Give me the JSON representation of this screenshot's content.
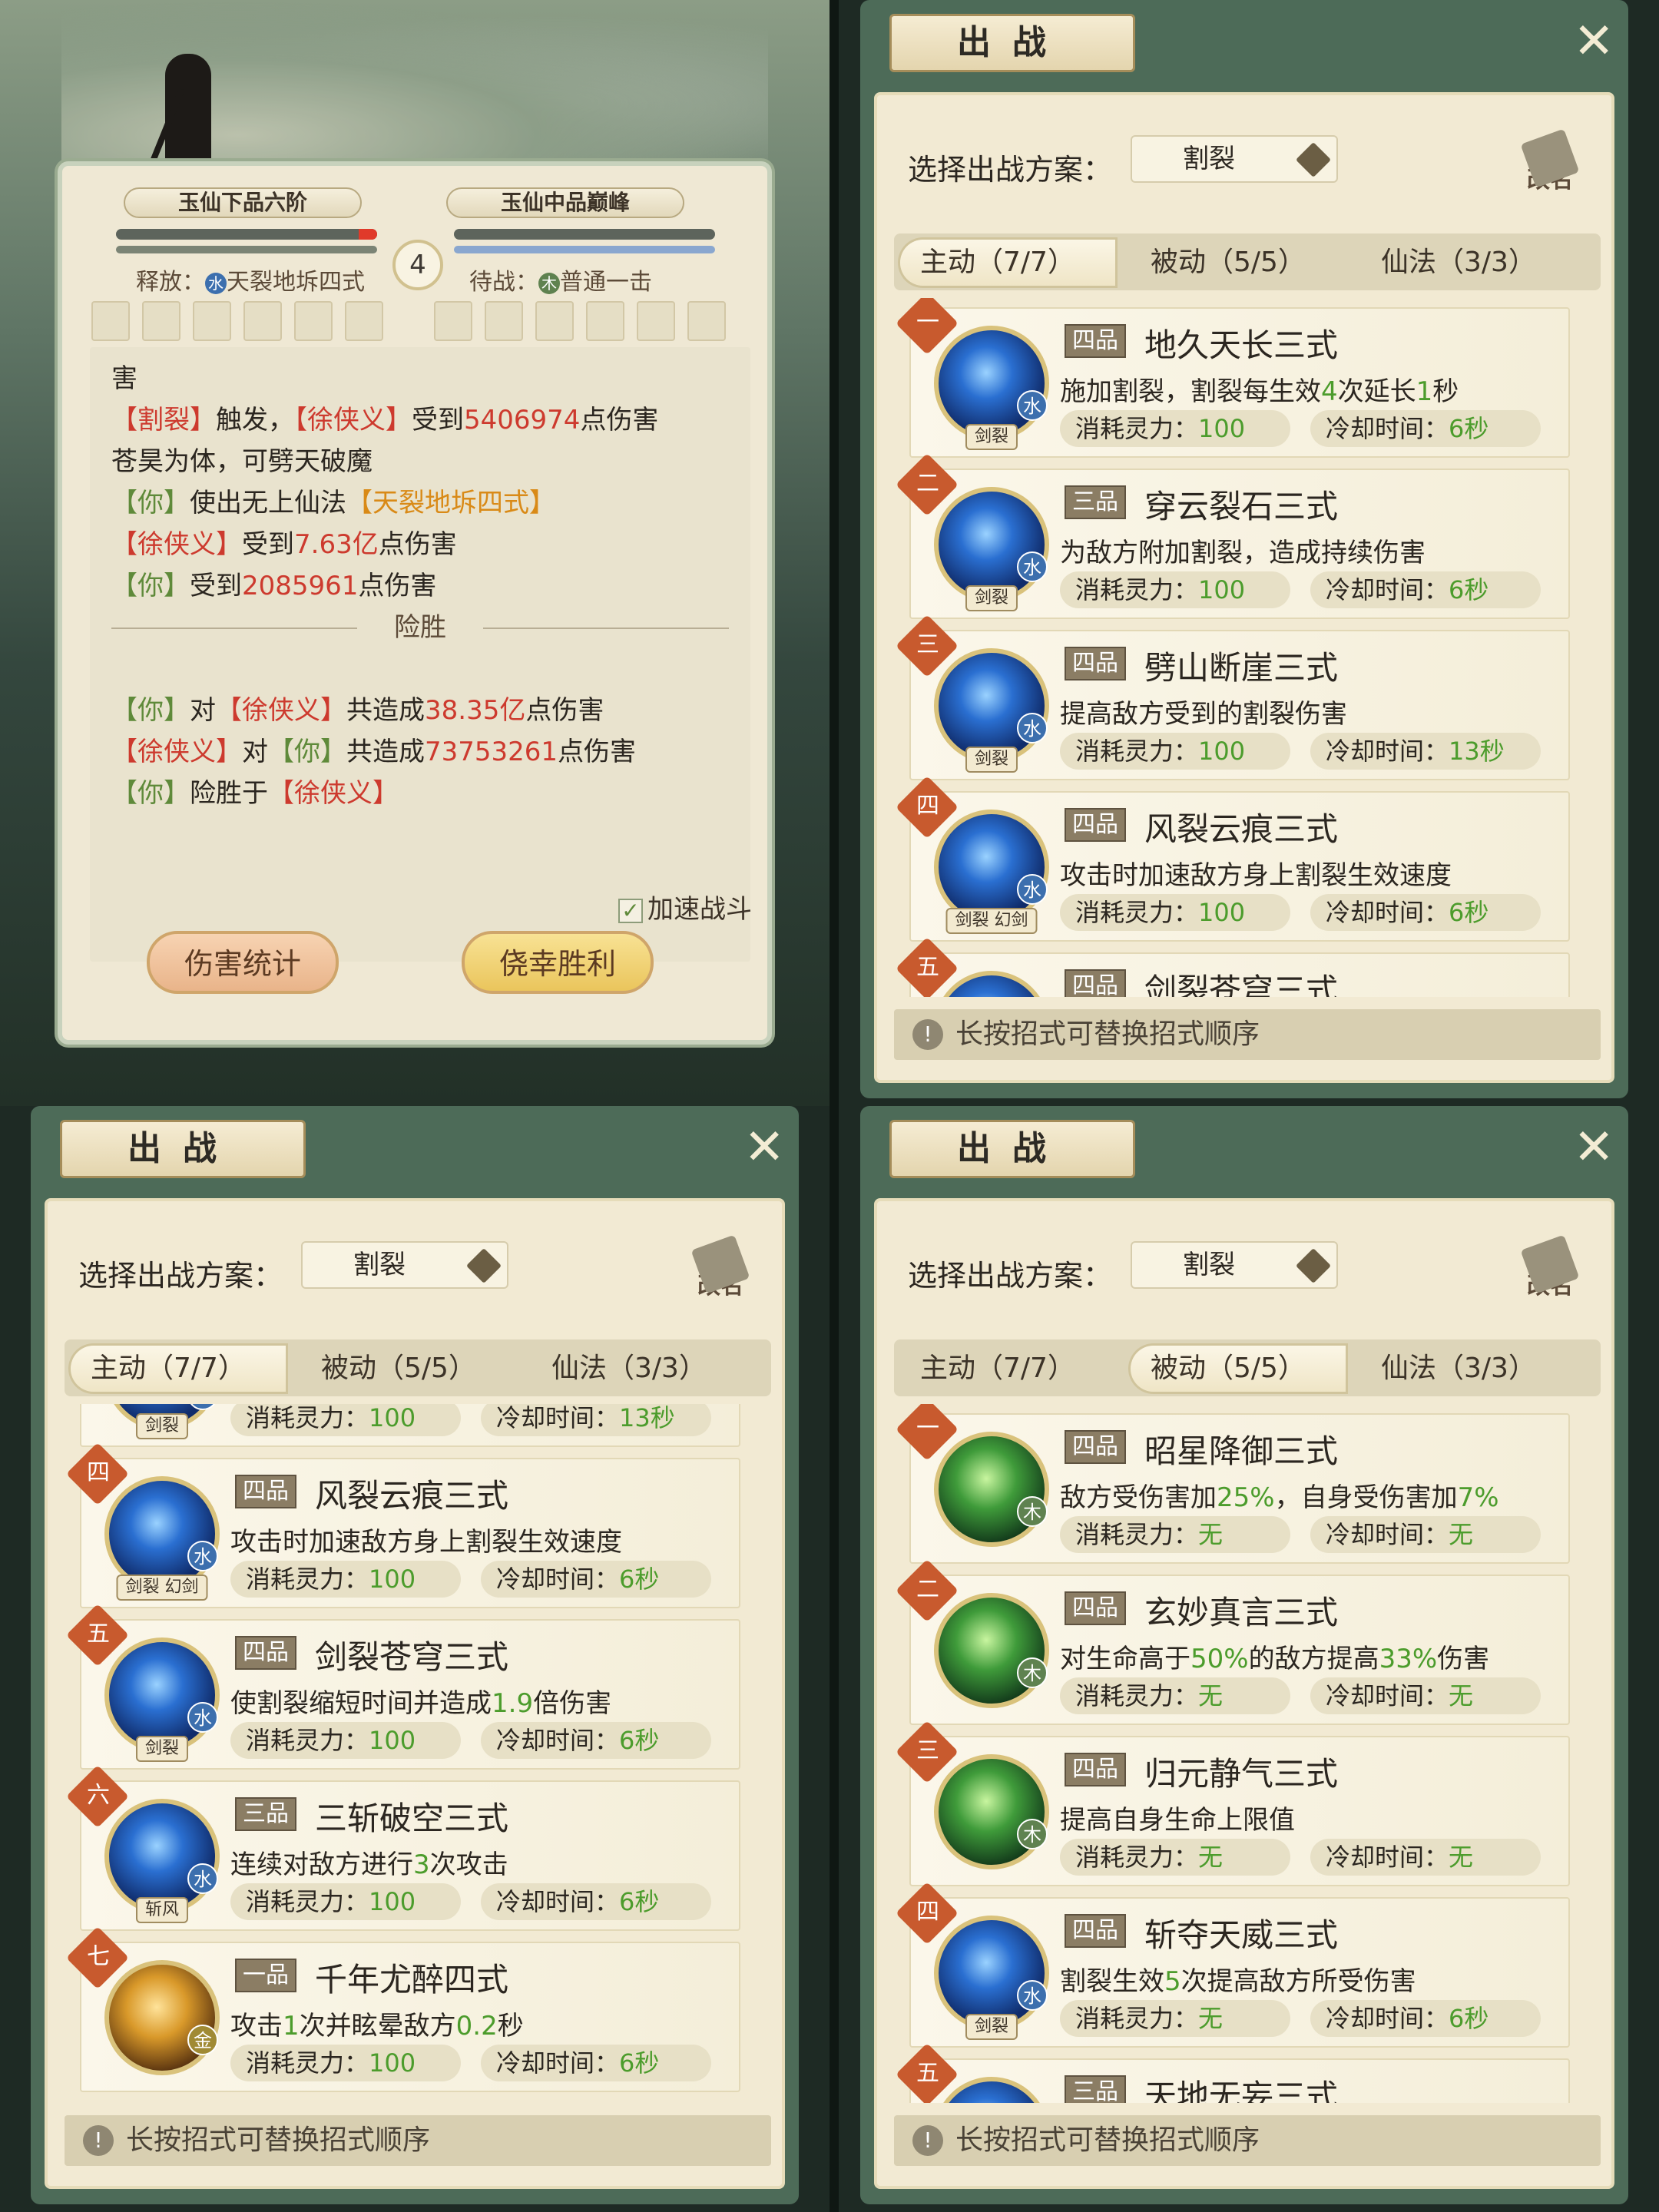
{
  "battle": {
    "rank_left": "玉仙下品六阶",
    "rank_right": "玉仙中品巅峰",
    "round": "4",
    "release_label": "释放：",
    "release_elem": "水",
    "release_skill": "天裂地坼四式",
    "wait_label": "待战：",
    "wait_elem": "木",
    "wait_skill": "普通一击",
    "hp_left_fraction": 0.07,
    "hp_right_fraction": 1.0,
    "log": [
      [
        {
          "t": "害",
          "c": ""
        }
      ],
      [
        {
          "t": "【割裂】",
          "c": "r"
        },
        {
          "t": "触发，",
          "c": ""
        },
        {
          "t": "【徐侠义】",
          "c": "r"
        },
        {
          "t": "受到",
          "c": ""
        },
        {
          "t": "5406974",
          "c": "r"
        },
        {
          "t": "点伤害",
          "c": ""
        }
      ],
      [
        {
          "t": " ",
          "c": ""
        }
      ],
      [
        {
          "t": "苍昊为体，可劈天破魔",
          "c": ""
        }
      ],
      [
        {
          "t": "【你】",
          "c": "g"
        },
        {
          "t": "使出无上仙法",
          "c": ""
        },
        {
          "t": "【天裂地坼四式】",
          "c": "o"
        }
      ],
      [
        {
          "t": "【徐侠义】",
          "c": "r"
        },
        {
          "t": "受到",
          "c": ""
        },
        {
          "t": "7.63亿",
          "c": "r"
        },
        {
          "t": "点伤害",
          "c": ""
        }
      ],
      [
        {
          "t": "【你】",
          "c": "g"
        },
        {
          "t": "受到",
          "c": ""
        },
        {
          "t": "2085961",
          "c": "r"
        },
        {
          "t": "点伤害",
          "c": ""
        }
      ]
    ],
    "result_title": "险胜",
    "summary": [
      [
        {
          "t": "【你】",
          "c": "g"
        },
        {
          "t": "对",
          "c": ""
        },
        {
          "t": "【徐侠义】",
          "c": "r"
        },
        {
          "t": "共造成",
          "c": ""
        },
        {
          "t": "38.35亿",
          "c": "r"
        },
        {
          "t": "点伤害",
          "c": ""
        }
      ],
      [
        {
          "t": "【徐侠义】",
          "c": "r"
        },
        {
          "t": "对",
          "c": ""
        },
        {
          "t": "【你】",
          "c": "g"
        },
        {
          "t": "共造成",
          "c": ""
        },
        {
          "t": "73753261",
          "c": "r"
        },
        {
          "t": "点伤害",
          "c": ""
        }
      ],
      [
        {
          "t": "【你】",
          "c": "g"
        },
        {
          "t": "险胜于",
          "c": ""
        },
        {
          "t": "【徐侠义】",
          "c": "r"
        }
      ]
    ],
    "speed_label": "加速战斗",
    "btn_stats": "伤害统计",
    "btn_win": "侥幸胜利"
  },
  "deploy": {
    "title": "出战",
    "plan_label": "选择出战方案：",
    "plan_value": "割裂",
    "rename": "改名",
    "tab_active": "主动（7/7）",
    "tab_passive": "被动（5/5）",
    "tab_magic": "仙法（3/3）",
    "tip": "长按招式可替换招式顺序",
    "cost_label": "消耗灵力：",
    "cd_label": "冷却时间："
  },
  "active_skills": [
    {
      "rank": "一",
      "grade": "四品",
      "name": "地久天长三式",
      "desc": "施加割裂，割裂每生效4次延长1秒",
      "elem": "水",
      "tag": "剑裂",
      "cost": "100",
      "cd": "6秒"
    },
    {
      "rank": "二",
      "grade": "三品",
      "name": "穿云裂石三式",
      "desc": "为敌方附加割裂，造成持续伤害",
      "elem": "水",
      "tag": "剑裂",
      "cost": "100",
      "cd": "6秒"
    },
    {
      "rank": "三",
      "grade": "四品",
      "name": "劈山断崖三式",
      "desc": "提高敌方受到的割裂伤害",
      "elem": "水",
      "tag": "剑裂",
      "cost": "100",
      "cd": "13秒"
    },
    {
      "rank": "四",
      "grade": "四品",
      "name": "风裂云痕三式",
      "desc": "攻击时加速敌方身上割裂生效速度",
      "elem": "水",
      "tag": "剑裂 幻剑",
      "cost": "100",
      "cd": "6秒"
    },
    {
      "rank": "五",
      "grade": "四品",
      "name": "剑裂苍穹三式",
      "desc": "",
      "elem": "水",
      "tag": "剑裂",
      "cost": "",
      "cd": ""
    }
  ],
  "active_skills_scrolled": [
    {
      "rank": "",
      "grade": "",
      "name": "",
      "desc": "提高敌方受到的割裂伤害",
      "elem": "水",
      "tag": "剑裂",
      "cost": "100",
      "cd": "13秒"
    },
    {
      "rank": "四",
      "grade": "四品",
      "name": "风裂云痕三式",
      "desc": "攻击时加速敌方身上割裂生效速度",
      "elem": "水",
      "tag": "剑裂 幻剑",
      "cost": "100",
      "cd": "6秒"
    },
    {
      "rank": "五",
      "grade": "四品",
      "name": "剑裂苍穹三式",
      "desc": "使割裂缩短时间并造成1.9倍伤害",
      "elem": "水",
      "tag": "剑裂",
      "cost": "100",
      "cd": "6秒"
    },
    {
      "rank": "六",
      "grade": "三品",
      "name": "三斩破空三式",
      "desc": "连续对敌方进行3次攻击",
      "elem": "水",
      "tag": "斩风",
      "cost": "100",
      "cd": "6秒"
    },
    {
      "rank": "七",
      "grade": "一品",
      "name": "千年尤醉四式",
      "desc": "攻击1次并眩晕敌方0.2秒",
      "elem": "金",
      "tag": "",
      "cost": "100",
      "cd": "6秒"
    }
  ],
  "passive_skills": [
    {
      "rank": "一",
      "grade": "四品",
      "name": "昭星降御三式",
      "desc": "敌方受伤害加25%，自身受伤害加7%",
      "elem": "木",
      "tag": "",
      "cost": "无",
      "cd": "无"
    },
    {
      "rank": "二",
      "grade": "四品",
      "name": "玄妙真言三式",
      "desc": "对生命高于50%的敌方提高33%伤害",
      "elem": "木",
      "tag": "",
      "cost": "无",
      "cd": "无"
    },
    {
      "rank": "三",
      "grade": "四品",
      "name": "归元静气三式",
      "desc": "提高自身生命上限值",
      "elem": "木",
      "tag": "",
      "cost": "无",
      "cd": "无"
    },
    {
      "rank": "四",
      "grade": "四品",
      "name": "斩夺天威三式",
      "desc": "割裂生效5次提高敌方所受伤害",
      "elem": "水",
      "tag": "剑裂",
      "cost": "无",
      "cd": "6秒"
    },
    {
      "rank": "五",
      "grade": "三品",
      "name": "天地无妄三式",
      "desc": "",
      "elem": "",
      "tag": "",
      "cost": "",
      "cd": ""
    }
  ]
}
